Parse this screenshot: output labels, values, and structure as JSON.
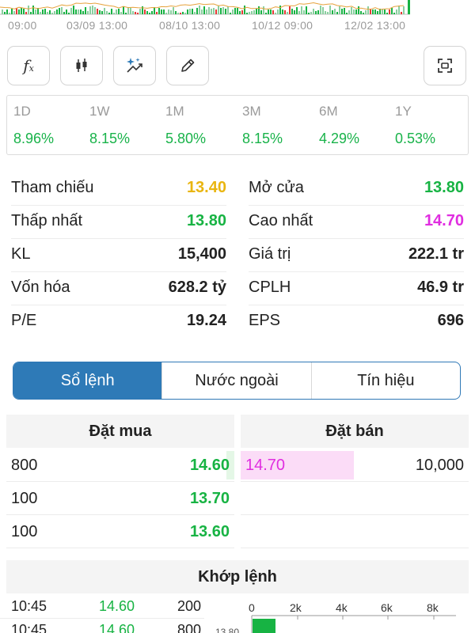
{
  "chart_strip": {
    "times": [
      "09:00",
      "03/09 13:00",
      "08/10 13:00",
      "10/12 09:00",
      "12/02 13:00"
    ]
  },
  "toolbar": {
    "buttons": [
      "function-icon",
      "candlestick-icon",
      "magic-wand-icon",
      "pencil-icon",
      "scan-icon"
    ]
  },
  "performance": [
    {
      "label": "1D",
      "value": "8.96%"
    },
    {
      "label": "1W",
      "value": "8.15%"
    },
    {
      "label": "1M",
      "value": "5.80%"
    },
    {
      "label": "3M",
      "value": "8.15%"
    },
    {
      "label": "6M",
      "value": "4.29%"
    },
    {
      "label": "1Y",
      "value": "0.53%"
    }
  ],
  "stats": {
    "left": [
      {
        "label": "Tham chiếu",
        "value": "13.40",
        "color": "#e9b510"
      },
      {
        "label": "Thấp nhất",
        "value": "13.80",
        "color": "#17b343"
      },
      {
        "label": "KL",
        "value": "15,400",
        "color": "#222222"
      },
      {
        "label": "Vốn hóa",
        "value": "628.2 tỷ",
        "color": "#222222"
      },
      {
        "label": "P/E",
        "value": "19.24",
        "color": "#222222"
      }
    ],
    "right": [
      {
        "label": "Mở cửa",
        "value": "13.80",
        "color": "#17b343"
      },
      {
        "label": "Cao nhất",
        "value": "14.70",
        "color": "#e02ee0"
      },
      {
        "label": "Giá trị",
        "value": "222.1 tr",
        "color": "#222222"
      },
      {
        "label": "CPLH",
        "value": "46.9 tr",
        "color": "#222222"
      },
      {
        "label": "EPS",
        "value": "696",
        "color": "#222222"
      }
    ]
  },
  "tabs": [
    {
      "label": "Sổ lệnh",
      "active": true
    },
    {
      "label": "Nước ngoài",
      "active": false
    },
    {
      "label": "Tín hiệu",
      "active": false
    }
  ],
  "order_book": {
    "buy_header": "Đặt mua",
    "sell_header": "Đặt bán",
    "buy": [
      {
        "volume": "800",
        "price": "14.60"
      },
      {
        "volume": "100",
        "price": "13.70"
      },
      {
        "volume": "100",
        "price": "13.60"
      }
    ],
    "sell": [
      {
        "price": "14.70",
        "volume": "10,000"
      }
    ]
  },
  "matched": {
    "header": "Khớp lệnh",
    "rows": [
      {
        "time": "10:45",
        "price": "14.60",
        "volume": "200"
      },
      {
        "time": "10:45",
        "price": "14.60",
        "volume": "800"
      }
    ],
    "volume_ticks": [
      "0",
      "2k",
      "4k",
      "6k",
      "8k"
    ],
    "price_tick": "13.80"
  },
  "colors": {
    "accent": "#2e7ab7",
    "up": "#17b343",
    "reference": "#e9b510",
    "ceiling": "#e02ee0"
  }
}
